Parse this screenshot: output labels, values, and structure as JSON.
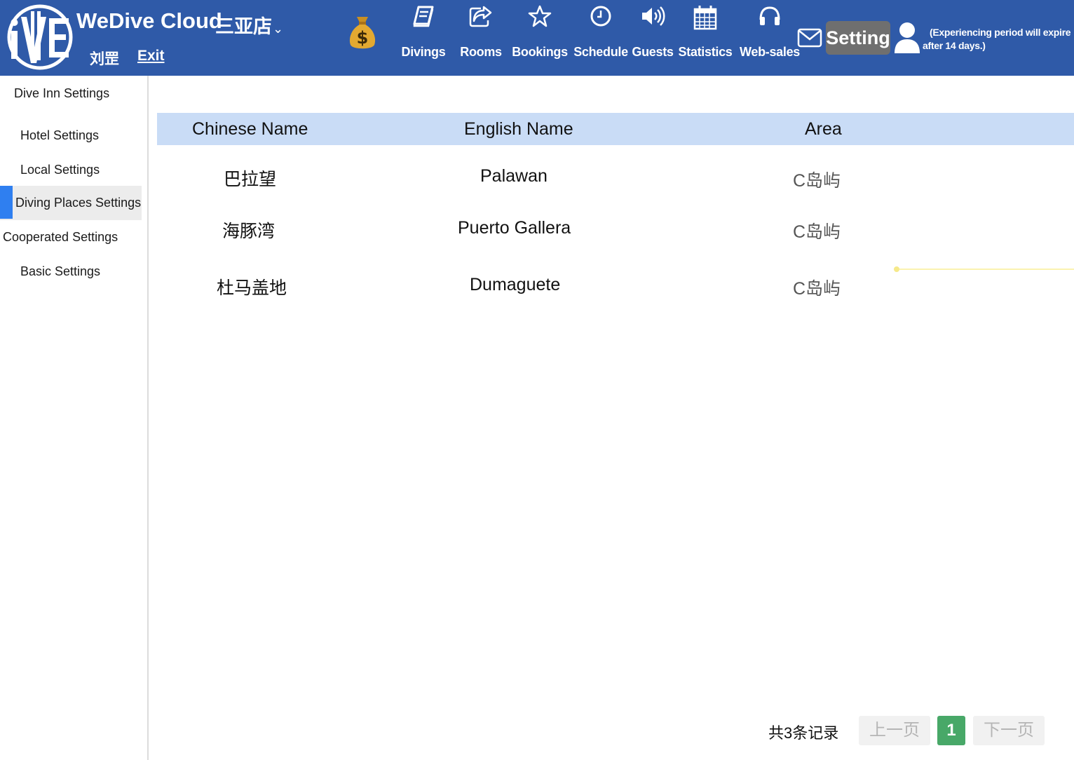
{
  "header": {
    "brand": "WeDive Cloud",
    "shop": "三亚店",
    "user": "刘罡",
    "exit": "Exit",
    "nav": [
      {
        "label": "Divings",
        "icon": "book-icon"
      },
      {
        "label": "Rooms",
        "icon": "share-icon"
      },
      {
        "label": "Bookings",
        "icon": "star-icon"
      },
      {
        "label": "Schedule",
        "icon": "clock-icon"
      },
      {
        "label": "Guests",
        "icon": "speaker-icon"
      },
      {
        "label": "Statistics",
        "icon": "calendar-icon"
      },
      {
        "label": "Web-sales",
        "icon": "headphones-icon"
      }
    ],
    "setting": "Setting",
    "expire_line1": "(Experiencing period will expire",
    "expire_line2": "after 14 days.)"
  },
  "sidebar": {
    "items": [
      {
        "label": "Dive Inn Settings"
      },
      {
        "label": "Hotel Settings"
      },
      {
        "label": "Local Settings"
      },
      {
        "label": "Diving Places Settings",
        "active": true
      },
      {
        "label": "Cooperated Settings"
      },
      {
        "label": "Basic Settings"
      }
    ]
  },
  "table": {
    "headers": [
      "Chinese Name",
      "English Name",
      "Area"
    ],
    "rows": [
      {
        "chinese": "巴拉望",
        "english": "Palawan",
        "area": "C岛屿"
      },
      {
        "chinese": "海豚湾",
        "english": "Puerto Gallera",
        "area": "C岛屿"
      },
      {
        "chinese": "杜马盖地",
        "english": "Dumaguete",
        "area": "C岛屿"
      }
    ]
  },
  "pagination": {
    "total": "共3条记录",
    "prev": "上一页",
    "current": "1",
    "next": "下一页"
  },
  "colors": {
    "header_bg": "#2f5aa8",
    "table_head_bg": "#c9dcf6",
    "active_bar": "#2f7ff0",
    "page_current": "#48a868"
  }
}
